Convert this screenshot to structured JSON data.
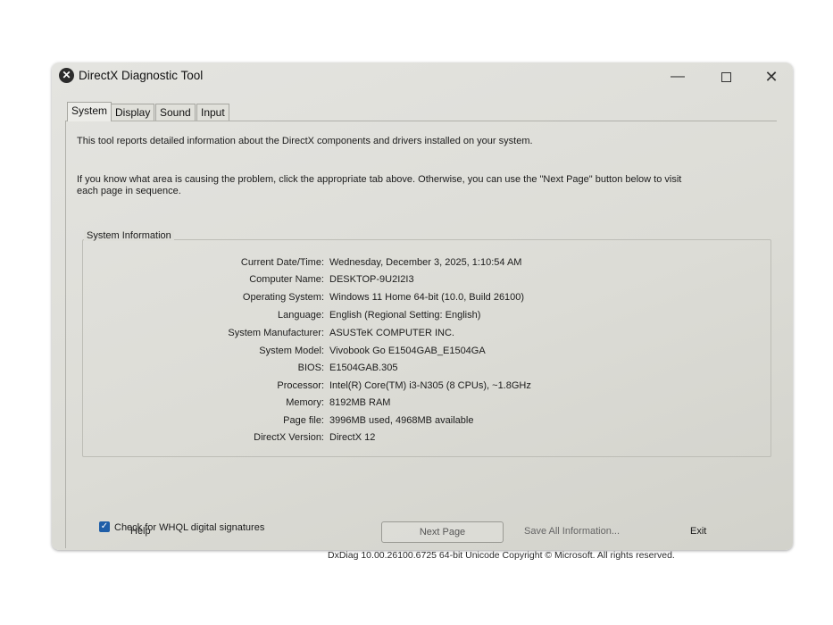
{
  "window": {
    "title": "DirectX Diagnostic Tool",
    "app_icon": "x-circle-icon"
  },
  "titlebar_buttons": {
    "minimize": "—",
    "close": "✕"
  },
  "tabs": [
    {
      "label": "System",
      "active": true
    },
    {
      "label": "Display",
      "active": false
    },
    {
      "label": "Sound",
      "active": false
    },
    {
      "label": "Input",
      "active": false
    }
  ],
  "content": {
    "intro": "This tool reports detailed information about the DirectX components and drivers installed on your system.",
    "instructions": "If you know what area is causing the problem, click the appropriate tab above.  Otherwise, you can use the \"Next Page\" button below to visit each page in sequence."
  },
  "system_info": {
    "group_label": "System Information",
    "rows": [
      {
        "label": "Current Date/Time:",
        "value": "Wednesday, December 3, 2025, 1:10:54 AM"
      },
      {
        "label": "Computer Name:",
        "value": "DESKTOP-9U2I2I3"
      },
      {
        "label": "Operating System:",
        "value": "Windows 11 Home 64-bit (10.0, Build 26100)"
      },
      {
        "label": "Language:",
        "value": "English (Regional Setting: English)"
      },
      {
        "label": "System Manufacturer:",
        "value": "ASUSTeK COMPUTER INC."
      },
      {
        "label": "System Model:",
        "value": "Vivobook Go E1504GAB_E1504GA"
      },
      {
        "label": "BIOS:",
        "value": "E1504GAB.305"
      },
      {
        "label": "Processor:",
        "value": "Intel(R) Core(TM) i3-N305 (8 CPUs), ~1.8GHz"
      },
      {
        "label": "Memory:",
        "value": "8192MB RAM"
      },
      {
        "label": "Page file:",
        "value": "3996MB used, 4968MB available"
      },
      {
        "label": "DirectX Version:",
        "value": "DirectX 12"
      }
    ]
  },
  "whql": {
    "label": "Check for WHQL digital signatures",
    "checked": true,
    "check_glyph": "✓"
  },
  "footer": {
    "copyright": "DxDiag 10.00.26100.6725 64-bit Unicode  Copyright © Microsoft. All rights reserved."
  },
  "buttons": {
    "help": "Help",
    "next_page": "Next Page",
    "save_all": "Save All Information...",
    "exit": "Exit"
  },
  "colors": {
    "accent": "#1f5ea8",
    "window_bg": "#dcdcd6"
  }
}
